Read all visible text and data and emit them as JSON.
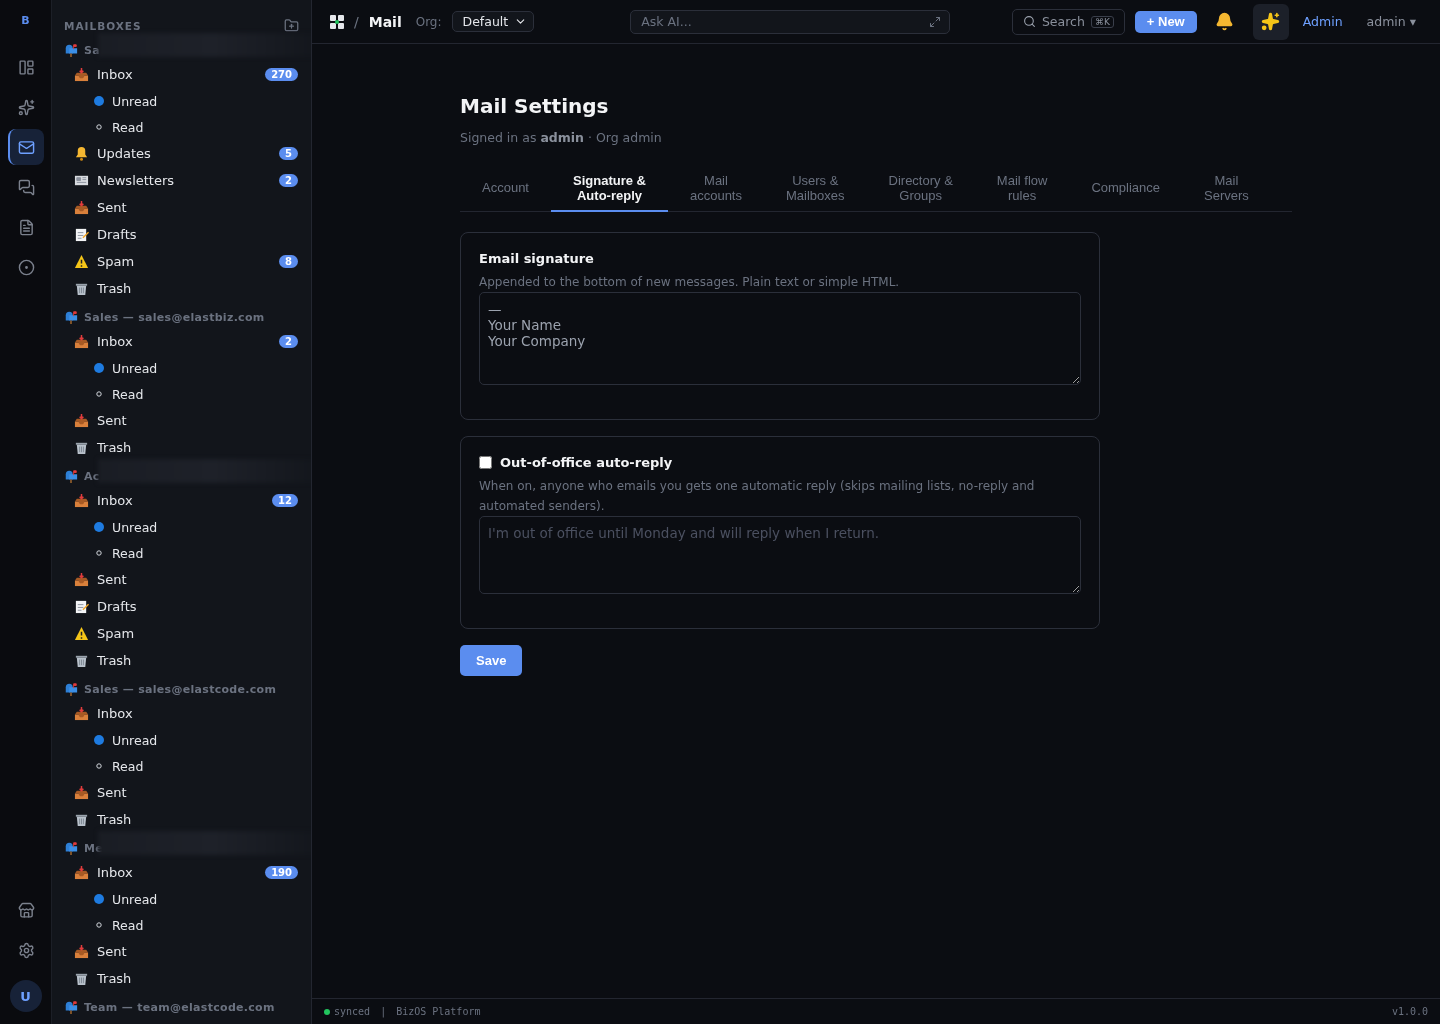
{
  "rail": {
    "logo": "B",
    "items": [
      {
        "kind": "layout",
        "selected": false
      },
      {
        "kind": "sparkles",
        "selected": false
      },
      {
        "kind": "mail",
        "selected": true
      },
      {
        "kind": "chat",
        "selected": false
      },
      {
        "kind": "document",
        "selected": false
      },
      {
        "kind": "target",
        "selected": false
      }
    ],
    "bottom_items": [
      {
        "kind": "store"
      },
      {
        "kind": "settings"
      }
    ],
    "avatar": "U"
  },
  "sidebar": {
    "title": "MAILBOXES",
    "mailboxes": [
      {
        "name": "Sa",
        "blurred": true,
        "folders": [
          {
            "kind": "inbox",
            "label": "Inbox",
            "count": "270",
            "children": [
              {
                "kind": "unread",
                "label": "Unread"
              },
              {
                "kind": "read",
                "label": "Read"
              }
            ]
          },
          {
            "kind": "updates",
            "label": "Updates",
            "count": "5"
          },
          {
            "kind": "newsletters",
            "label": "Newsletters",
            "count": "2"
          },
          {
            "kind": "sent",
            "label": "Sent"
          },
          {
            "kind": "drafts",
            "label": "Drafts"
          },
          {
            "kind": "spam",
            "label": "Spam",
            "count": "8"
          },
          {
            "kind": "trash",
            "label": "Trash"
          }
        ]
      },
      {
        "name": "Sales — sales@elastbiz.com",
        "blurred": false,
        "folders": [
          {
            "kind": "inbox",
            "label": "Inbox",
            "count": "2",
            "children": [
              {
                "kind": "unread",
                "label": "Unread"
              },
              {
                "kind": "read",
                "label": "Read"
              }
            ]
          },
          {
            "kind": "sent",
            "label": "Sent"
          },
          {
            "kind": "trash",
            "label": "Trash"
          }
        ]
      },
      {
        "name": "Ac",
        "blurred": true,
        "folders": [
          {
            "kind": "inbox",
            "label": "Inbox",
            "count": "12",
            "children": [
              {
                "kind": "unread",
                "label": "Unread"
              },
              {
                "kind": "read",
                "label": "Read"
              }
            ]
          },
          {
            "kind": "sent",
            "label": "Sent"
          },
          {
            "kind": "drafts",
            "label": "Drafts"
          },
          {
            "kind": "spam",
            "label": "Spam"
          },
          {
            "kind": "trash",
            "label": "Trash"
          }
        ]
      },
      {
        "name": "Sales — sales@elastcode.com",
        "blurred": false,
        "folders": [
          {
            "kind": "inbox",
            "label": "Inbox",
            "children": [
              {
                "kind": "unread",
                "label": "Unread"
              },
              {
                "kind": "read",
                "label": "Read"
              }
            ]
          },
          {
            "kind": "sent",
            "label": "Sent"
          },
          {
            "kind": "trash",
            "label": "Trash"
          }
        ]
      },
      {
        "name": "Me",
        "blurred": true,
        "folders": [
          {
            "kind": "inbox",
            "label": "Inbox",
            "count": "190",
            "children": [
              {
                "kind": "unread",
                "label": "Unread"
              },
              {
                "kind": "read",
                "label": "Read"
              }
            ]
          },
          {
            "kind": "sent",
            "label": "Sent"
          },
          {
            "kind": "trash",
            "label": "Trash"
          }
        ]
      },
      {
        "name": "Team — team@elastcode.com",
        "blurred": false
      }
    ]
  },
  "topbar": {
    "separator": "/",
    "section": "Mail",
    "org_label": "Org:",
    "org_value": "Default",
    "ask_placeholder": "Ask AI...",
    "search_label": "Search",
    "search_shortcut": "⌘K",
    "new_button": "+ New",
    "admin_link": "Admin",
    "user_menu": "admin ▾"
  },
  "page": {
    "title": "Mail Settings",
    "subtitle": "Signed in as **admin** · Org admin",
    "tabs": [
      {
        "label": "Account",
        "selected": false
      },
      {
        "label": "Signature &\nAuto-reply",
        "selected": true
      },
      {
        "label": "Mail\naccounts",
        "selected": false
      },
      {
        "label": "Users &\nMailboxes",
        "selected": false
      },
      {
        "label": "Directory &\nGroups",
        "selected": false
      },
      {
        "label": "Mail flow\nrules",
        "selected": false
      },
      {
        "label": "Compliance",
        "selected": false
      },
      {
        "label": "Mail\nServers",
        "selected": false
      }
    ],
    "signature": {
      "title": "Email signature",
      "hint": "Appended to the bottom of new messages. Plain text or simple HTML.",
      "value": "—\nYour Name\nYour Company"
    },
    "auto_reply": {
      "title": "Out-of-office auto-reply",
      "checked": false,
      "hint": "When on, anyone who emails you gets one automatic reply (skips mailing lists, no-reply and automated senders).",
      "placeholder": "I'm out of office until Monday and will reply when I return."
    },
    "save_button": "Save"
  },
  "status_bar": {
    "status": "synced",
    "separator": "|",
    "platform": "BizOS Platform",
    "version": "v1.0.0"
  }
}
